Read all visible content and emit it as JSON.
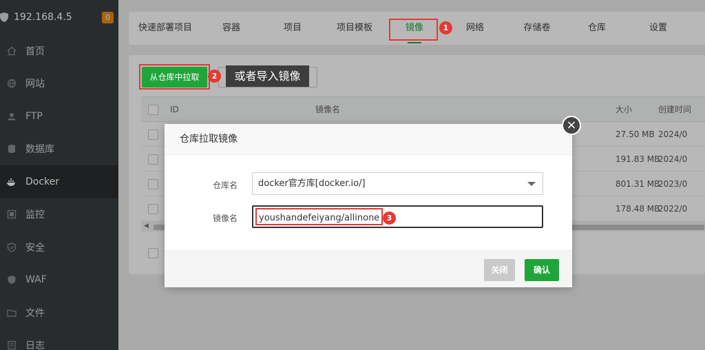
{
  "sidebar": {
    "server_ip": "192.168.4.5",
    "badge": "0",
    "items": [
      {
        "label": "首页",
        "icon": "home-icon"
      },
      {
        "label": "网站",
        "icon": "globe-icon"
      },
      {
        "label": "FTP",
        "icon": "ftp-icon"
      },
      {
        "label": "数据库",
        "icon": "database-icon"
      },
      {
        "label": "Docker",
        "icon": "docker-icon"
      },
      {
        "label": "监控",
        "icon": "monitor-icon"
      },
      {
        "label": "安全",
        "icon": "shield-icon"
      },
      {
        "label": "WAF",
        "icon": "waf-icon"
      },
      {
        "label": "文件",
        "icon": "folder-icon"
      },
      {
        "label": "日志",
        "icon": "log-icon"
      }
    ],
    "active_index": 4
  },
  "tabs": [
    "快速部署项目",
    "容器",
    "项目",
    "项目模板",
    "镜像",
    "网络",
    "存储卷",
    "仓库",
    "设置"
  ],
  "active_tab": "镜像",
  "annotations": {
    "n1": "1",
    "n2": "2",
    "n3": "3"
  },
  "toolbar": {
    "pull_label": "从仓库中拉取",
    "tooltip": "或者导入镜像"
  },
  "table": {
    "headers": {
      "id": "ID",
      "name": "镜像名",
      "size": "大小",
      "created": "创建时间"
    },
    "rows": [
      {
        "size": "27.50 MB",
        "created": "2024/0"
      },
      {
        "size": "191.83 MB",
        "created": "2024/0"
      },
      {
        "size": "801.31 MB",
        "created": "2023/0"
      },
      {
        "size": "178.48 MB",
        "created": "2022/0"
      }
    ]
  },
  "modal": {
    "title": "仓库拉取镜像",
    "repo_label": "仓库名",
    "repo_value": "docker官方库[docker.io/]",
    "image_label": "镜像名",
    "image_value": "youshandefeiyang/allinone",
    "close_label": "关闭",
    "confirm_label": "确认"
  },
  "colors": {
    "accent": "#20a53a",
    "annotation": "#e53935",
    "sidebar": "#3a3d41"
  }
}
